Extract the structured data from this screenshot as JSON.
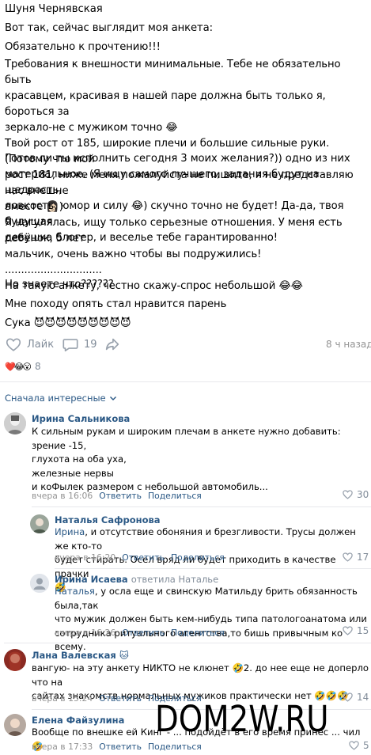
{
  "post": {
    "author": "Шуня Чернявская",
    "paragraphs": [
      "Вот так, сейчас выглядит моя анкета:",
      "Обязательно к прочтению!!!",
      "Требования к внешности минимальные. Тебе не обязательно быть\nкрасавцем, красивая в нашей паре должна быть только я, бороться за\nзеркало-не с мужиком точно 😂\nТвой рост от 185, широкие плечи и большие сильные руки. (Потому что мой\nрост 181, ниже меня пожалуйста не пишите, я не представляю нас внешне\nвместе 👩🏻)",
      "Готов ли ты исполнить сегодня 3 моих желания?)) одно из них\nматериальное. (Я ищу самого лучшего, задания будут на щедрость,\nловкость, юмор и силу 😂) скучно точно не будет! Да-да, твоя будущая\nдевушка блогер, и веселье тебе гарантированно!",
      "Я нагулялась, ищу только серьезные отношения. У меня есть ребёнок, 5 лет\nмальчик, очень важно чтобы вы подружились!\n..............................\nНа такую анкету, честно скажу-спрос небольшой 😂😂",
      "Но знаете что??????",
      "Мне походу опять стал нравится парень",
      "Сука 😈😈😈😈😈😈😈😈😈"
    ],
    "like_label": "Лайк",
    "comments_count": "19",
    "time": "8 ч назад",
    "reactions_emoji": "❤️😂😮",
    "reactions_count": "8",
    "sort_label": "Сначала интересные"
  },
  "comments": [
    {
      "name": "Ирина Сальникова",
      "badge": "",
      "reply_label": "",
      "mention": "",
      "text": "К сильным рукам и широким плечам в анкете нужно добавить:\nзрение -15,\nглухота на оба уха,\nжелезные нервы\nи коФылек размером с небольшой автомобиль...",
      "time": "вчера в 16:06",
      "reply": "Ответить",
      "share": "Поделиться",
      "likes": "30"
    },
    {
      "name": "Наталья Сафронова",
      "badge": "",
      "reply_label": "",
      "mention": "Ирина",
      "text": ", и отсутствие обоняния и брезгливости. Трусы должен же кто-то\nбудет стирать. Осел вряд ли будет приходить в качестве прачки\n🤣",
      "time": "вчера в 16:20",
      "reply": "Ответить",
      "share": "Поделиться",
      "likes": "17"
    },
    {
      "name": "Ирина Исаева",
      "badge": "",
      "reply_label": "ответила Наталье",
      "mention": "Наталья",
      "text": ", у осла еще и свинскую Матильду брить обязанность была,так\nчто мужик должен быть кем-нибудь типа патологоанатома или\nсотрудника ритуального агентства,то бишь привычным ко всему.",
      "time": "вчера в 16:26",
      "reply": "Ответить",
      "share": "Поделиться",
      "likes": "15"
    },
    {
      "name": "Лана Валевская",
      "badge": "🐱",
      "reply_label": "",
      "mention": "",
      "text": "вангую- на эту анкету НИКТО не клюнет 🤣2. до нее еще не доперло что на\nсайтах знакомств нормальных мужиков практически нет 🤣🤣🤣",
      "time": "вчера в 15:24",
      "reply": "Ответить",
      "share": "Поделиться",
      "likes": "14"
    },
    {
      "name": "Елена Файзулина",
      "badge": "",
      "reply_label": "",
      "mention": "",
      "text": "Вообще по внешке ей Кинг - ... подойдёт в его время принес ... чил 🤣",
      "time": "вчера в 17:33",
      "reply": "Ответить",
      "share": "Поделиться",
      "likes": "5"
    }
  ],
  "watermark": "DOM2W.RU",
  "colors": {
    "link": "#2a5885",
    "meta": "#939393",
    "icon": "#818c99",
    "divider": "#e7e8ec"
  }
}
